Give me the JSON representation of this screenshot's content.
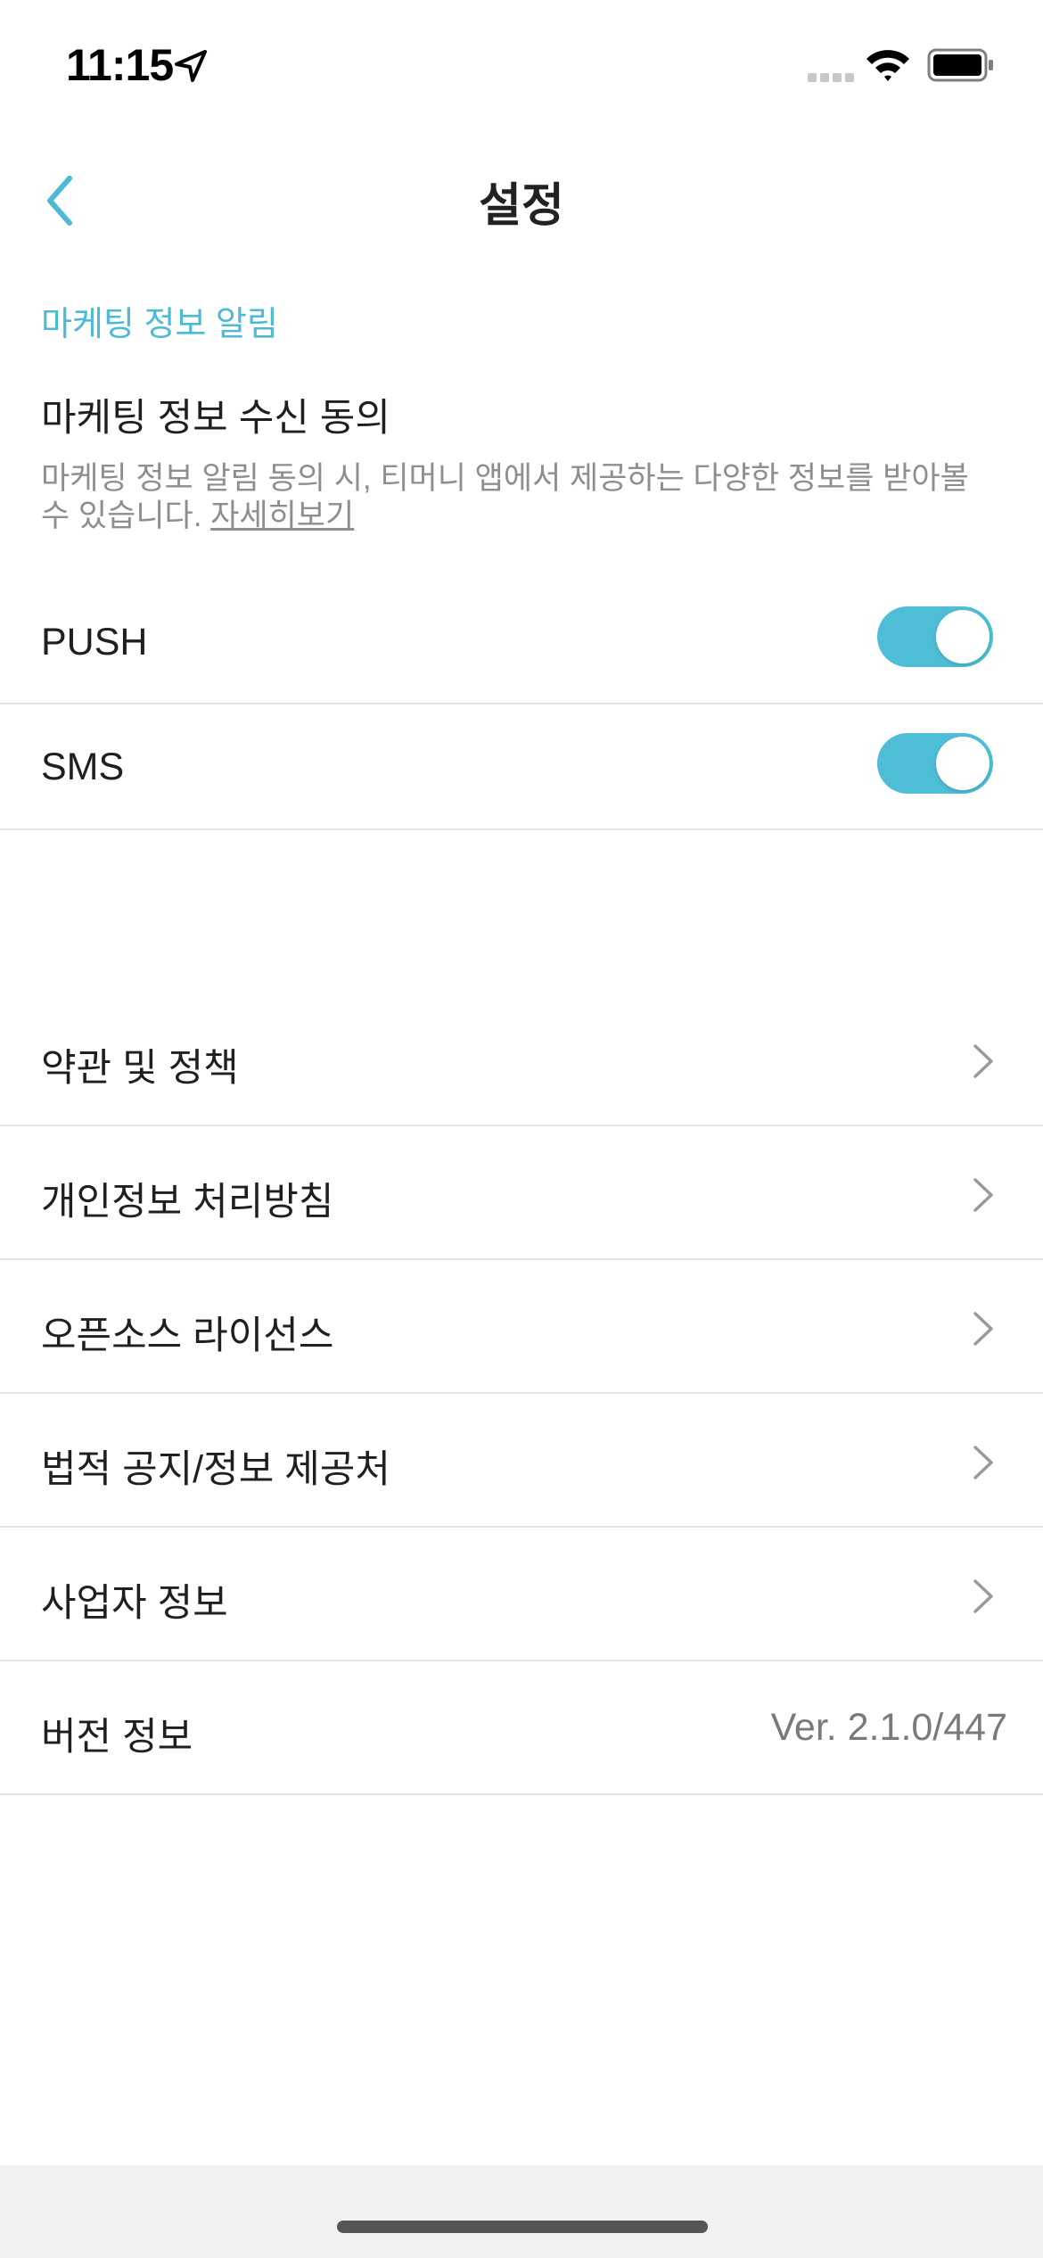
{
  "status_bar": {
    "time": "11:15"
  },
  "nav": {
    "title": "설정"
  },
  "marketing": {
    "section_label": "마케팅 정보 알림",
    "consent_title": "마케팅 정보 수신 동의",
    "consent_desc": "마케팅 정보 알림 동의 시, 티머니 앱에서 제공하는 다양한 정보를 받아볼 수 있습니다.",
    "more_link": "자세히보기",
    "toggles": [
      {
        "label": "PUSH",
        "on": true
      },
      {
        "label": "SMS",
        "on": true
      }
    ]
  },
  "menu": {
    "items": [
      {
        "label": "약관 및 정책"
      },
      {
        "label": "개인정보 처리방침"
      },
      {
        "label": "오픈소스 라이선스"
      },
      {
        "label": "법적 공지/정보 제공처"
      },
      {
        "label": "사업자 정보"
      }
    ],
    "version_label": "버전 정보",
    "version_value": "Ver. 2.1.0/447"
  },
  "colors": {
    "accent": "#4cb9d6",
    "toggle_on": "#4dbed6",
    "divider": "#e3e3e3"
  }
}
